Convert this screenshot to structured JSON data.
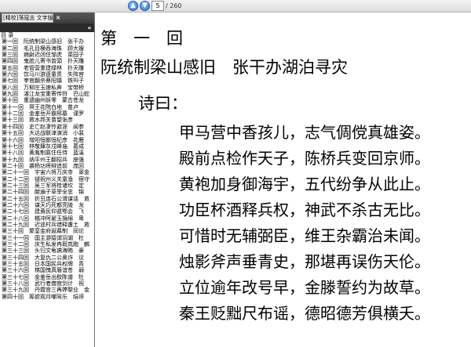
{
  "toolbar": {
    "page_current": "5",
    "page_total": "/ 260"
  },
  "left_panel": {
    "tab_title": "[精校]荡寇志 文字版",
    "outline": [
      "目 录",
      "第一回　阮统制梁山感旧　张干办",
      "第二回　毛孔目横吞海珠　顾大嫂",
      "第三回　病尉迟闭住邹虎　菜园子",
      "第四回　鬼脸儿寄书曾頭　扑天雕",
      "第五回　老管营重建绿林　扑天雕",
      "第六回　饮马川游逐童贯　失阵官",
      "第七回　宰官翻杀蔡阳镇　铁叫子",
      "第八回　万柳庄玉娘私奔　宝带桥",
      "第九回　湛江龙宝重寄传符　巴山蛇",
      "第十回　重遗幽州妖零　蒙古苍龙",
      "第十一回　冥王花院白地　苗卢",
      "第十二回　金鉴岳开霸邢墓　谨罗",
      "第十三回　救水邦关苗望张彦",
      "第十四回　史亡赵凄怜避涯　闻参",
      "第十五回　大达战联津演消　小裴",
      "第十六回　增阳恒鄙恒纪彦　花鹿",
      "第十七回　林敬肆灰戍峰庙　葛成",
      "第十八回　黄胤制扈住任侍　蓝溪",
      "第十九回　纳平州王翻招兵　座强",
      "第二十回　袭杨功将辩追前　庞回",
      "第二十一回　宇宙六将万庆寺　翠金",
      "第二十二回　褪祝州义关童渔　宿守",
      "第二十三回　吴三军将桂诸坎　定",
      "第二十四回　献遍子草举全忠　锦",
      "第二十五回　折丑连石公渭谋话　救",
      "第二十六回　谋天巧死都亮陵　龙",
      "第二十七回　建黄民仰遁鄂会　飞",
      "第二十八回　橘冲阿翟玉捐绵　卑",
      "第二十九回　迟遥村兵错释遭土　救",
      "第三十回　聚銮金府遐幕制　同论",
      "第三十一回　国主游猿谓羽湖　杜",
      "第三十二回　庆生私发冉瑕岚跑　麟",
      "第三十三回　头归文龟镐海贿　豪",
      "第三十四回　大复仇二公奥诈　议",
      "第三十五回　日本国民兵权牌　青",
      "第三十六回　梯国愧真眉谊苍　弱",
      "第三十七回　金鉴岳出鲛陈谱　牡",
      "第三十八回　武行者聋寂剑计　祝",
      "第三十九回　丹霞宫三再婷黎业　金",
      "第四十回　筹欲观月嘲驾乐　绢谛"
    ]
  },
  "document": {
    "chapter_number": "第　一　回",
    "chapter_title": "阮统制梁山感旧　张干办湖泊寻灾",
    "poem_intro": "诗曰：",
    "poem_lines": [
      "甲马营中香孩儿，志气倜傥真雄姿。",
      "殿前点检作天子，陈桥兵变回京师。",
      "黄袍加身御海宇，五代纷争从此止。",
      "功臣杯酒释兵权，神武不杀古无比。",
      "可惜时无辅弼臣，维王杂霸治未闻。",
      "烛影斧声垂青史，那堪再误伤天伦。",
      "立位逾年改号早，金滕誓约为故草。",
      "秦王贬黜尺布谣，德昭德芳俱横夭。"
    ]
  },
  "colors": {
    "toolbar_bg": "#dcdcdc",
    "left_tab_bg": "#3c3c3c",
    "nav_button": "#2a6fd6",
    "text": "#000000"
  },
  "icons": {
    "prev": "arrow-up-icon",
    "next": "arrow-down-icon",
    "close": "close-icon",
    "collapse": "double-chevron-left-icon"
  }
}
